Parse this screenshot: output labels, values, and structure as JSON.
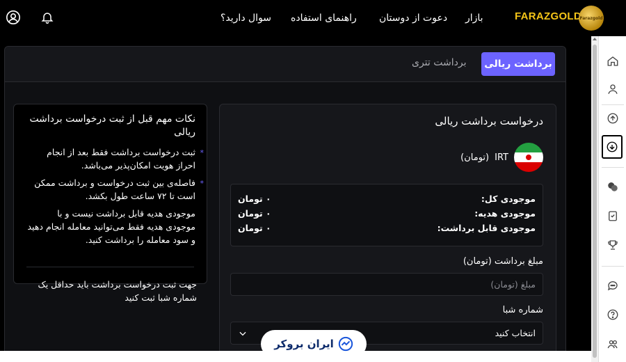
{
  "topbar": {
    "brand": "FARAZGOLD",
    "brand_logo_text": "Farazgold",
    "nav": [
      "بازار",
      "دعوت از دوستان",
      "راهنمای استفاده",
      "سوال دارید؟"
    ]
  },
  "tabs": {
    "active": "برداشت ریالی",
    "inactive": "برداشت تتری"
  },
  "notes": {
    "title": "نکات مهم قبل از ثبت درخواست برداشت ریالی",
    "items": [
      "ثبت درخواست برداشت فقط بعد از انجام احراز هویت امکان‌پذیر می‌باشد.",
      "فاصله‌ی بین ثبت درخواست و برداشت ممکن است تا ۷۲ ساعت طول بکشد."
    ],
    "paragraph": "موجودی هدیه قابل برداشت نیست و با موجودی هدیه فقط می‌توانید معامله انجام دهید و سود معامله را برداشت کنید.",
    "footer": "جهت ثبت درخواست برداشت باید حداقل یک شماره شبا ثبت کنید"
  },
  "form": {
    "title": "درخواست برداشت ریالی",
    "currency_code": "IRT",
    "currency_name": "(تومان)",
    "balances": [
      {
        "label": "موجودی کل:",
        "value": "۰ تومان"
      },
      {
        "label": "موجودی هدیه:",
        "value": "۰ تومان"
      },
      {
        "label": "موجودی قابل برداشت:",
        "value": "۰ تومان"
      }
    ],
    "amount_label": "مبلغ برداشت (تومان)",
    "amount_placeholder": "مبلغ (تومان)",
    "sheba_label": "شماره شبا",
    "sheba_value": "انتخاب کنید"
  },
  "watermark": {
    "text": "ایران بروکر"
  },
  "colors": {
    "accent": "#6c63ff",
    "brand": "#f5c518",
    "panel": "#16171b"
  }
}
